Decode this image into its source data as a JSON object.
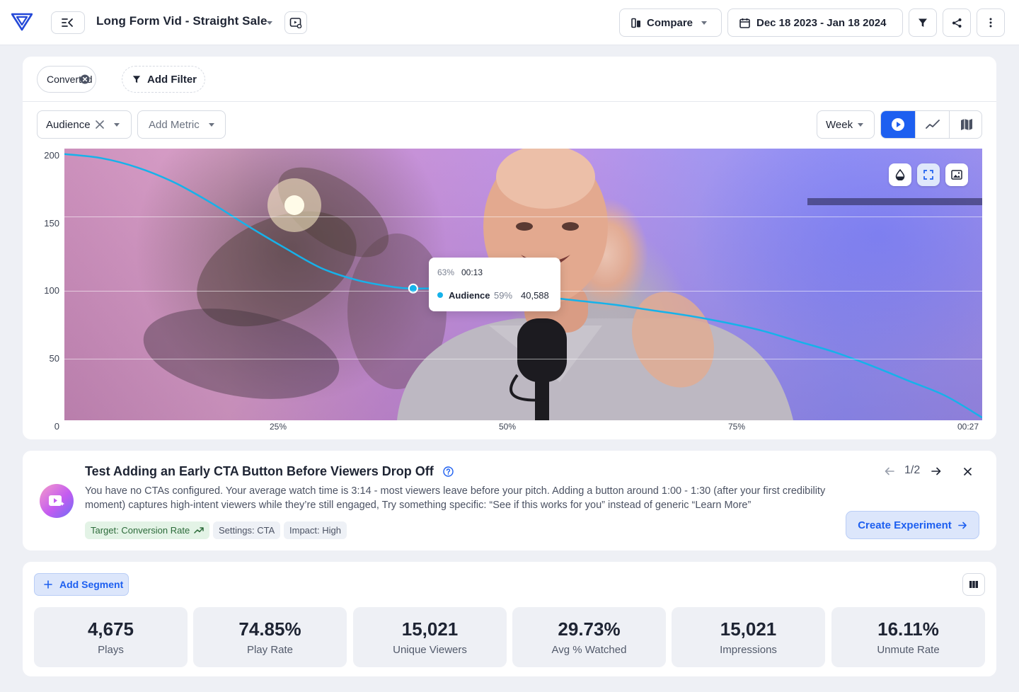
{
  "header": {
    "video_title": "Long Form Vid - Straight Sale",
    "compare_label": "Compare",
    "date_range": "Dec 18 2023 - Jan 18 2024",
    "icons": [
      "logo-icon",
      "collapse-sidebar-icon",
      "video-preview-icon",
      "compare-icon",
      "calendar-icon",
      "filter-icon",
      "share-icon",
      "more-vertical-icon"
    ]
  },
  "filters": {
    "active_filter": "Converted",
    "add_filter_label": "Add Filter"
  },
  "controls": {
    "metric_selected": "Audience",
    "add_metric_placeholder": "Add Metric",
    "interval": "Week",
    "view_modes": [
      "video-view",
      "line-view",
      "map-view"
    ],
    "active_view": "video-view"
  },
  "chart_data": {
    "type": "line",
    "title": "",
    "xlabel": "",
    "ylabel": "",
    "ylim": [
      0,
      200
    ],
    "y_ticks": [
      "200",
      "150",
      "100",
      "50",
      "0"
    ],
    "x_ticks": [
      "25%",
      "50%",
      "75%",
      "00:27"
    ],
    "xlim": [
      0,
      100
    ],
    "series": [
      {
        "name": "Audience",
        "color": "#16b2ea",
        "x": [
          0,
          4,
          8,
          12,
          16,
          20,
          24,
          28,
          32,
          36,
          38,
          40,
          44,
          48,
          52,
          56,
          60,
          64,
          68,
          72,
          76,
          80,
          84,
          88,
          92,
          96,
          100
        ],
        "y": [
          196,
          193,
          186,
          175,
          160,
          143,
          127,
          112,
          103,
          98,
          97,
          97,
          96,
          94,
          91,
          88,
          85,
          81,
          77,
          72,
          66,
          58,
          50,
          40,
          29,
          18,
          2
        ]
      }
    ],
    "grid": true,
    "highlight": {
      "x": 38,
      "y": 97
    }
  },
  "tooltip": {
    "position_pct": "63%",
    "time": "00:13",
    "series_name": "Audience",
    "series_pct": "59%",
    "value": "40,588"
  },
  "video_overlay_icons": [
    "color-drop-icon",
    "fullscreen-icon",
    "picture-icon"
  ],
  "recommendation": {
    "title": "Test Adding an Early CTA Button Before Viewers Drop Off",
    "body": "You have no CTAs configured. Your average watch time is 3:14 - most viewers leave before your pitch. Adding a button around 1:00 - 1:30 (after your first credibility moment) captures high-intent viewers while they’re still engaged, Try something specific: “See if this works for you” instead of generic “Learn More”",
    "pager": "1/2",
    "tags": [
      "Target: Conversion Rate",
      "Settings: CTA",
      "Impact: High"
    ],
    "cta_label": "Create Experiment"
  },
  "segments": {
    "add_segment_label": "Add Segment"
  },
  "stats": [
    {
      "value": "4,675",
      "label": "Plays"
    },
    {
      "value": "74.85%",
      "label": "Play Rate"
    },
    {
      "value": "15,021",
      "label": "Unique Viewers"
    },
    {
      "value": "29.73%",
      "label": "Avg % Watched"
    },
    {
      "value": "15,021",
      "label": "Impressions"
    },
    {
      "value": "16.11%",
      "label": "Unmute Rate"
    }
  ],
  "colors": {
    "accent": "#1d5ff0",
    "line": "#16b2ea",
    "tag_green_bg": "#e3f3e6",
    "tag_grey_bg": "#eef1f6",
    "cta_bg": "#dce6fb"
  }
}
